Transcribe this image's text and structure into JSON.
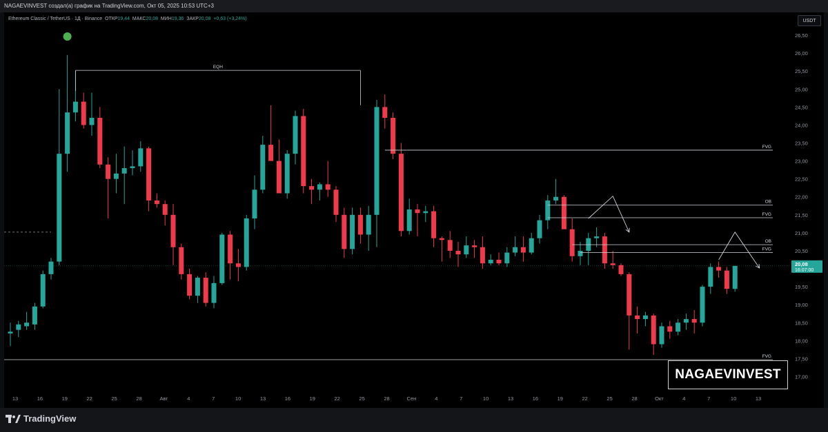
{
  "header": {
    "title": "NAGAEVINVEST создал(а) график на TradingView.com, Окт 05, 2025 10:53 UTC+3"
  },
  "legend": {
    "symbol": "Ethereum Classic / TetherUS · 1Д · Binance",
    "open_label": "ОТКР",
    "open": "19,44",
    "high_label": "МАКС",
    "high": "20,08",
    "low_label": "МИН",
    "low": "19,36",
    "close_label": "ЗАКР",
    "close": "20,08",
    "change": "+0,63 (+3,24%)"
  },
  "currency": "USDT",
  "price_badge": {
    "price": "20,08",
    "countdown": "16:07:00"
  },
  "watermark": "NAGAEVINVEST",
  "footer": {
    "logo_text": "TradingView"
  },
  "colors": {
    "up": "#26a69a",
    "down": "#ef3a4c",
    "line": "#d1d4dc",
    "marker": "#4caf50",
    "background": "#000000"
  },
  "chart_data": {
    "type": "candlestick",
    "ylim": [
      16.55,
      26.75
    ],
    "y_ticks": [
      "17,00",
      "17,50",
      "18,00",
      "18,50",
      "19,00",
      "19,50",
      "20,00",
      "20,50",
      "21,00",
      "21,50",
      "22,00",
      "22,50",
      "23,00",
      "23,50",
      "24,00",
      "24,50",
      "25,00",
      "25,50",
      "26,00",
      "26,50"
    ],
    "x_ticks": [
      "13",
      "16",
      "19",
      "22",
      "25",
      "28",
      "Авг",
      "4",
      "7",
      "10",
      "13",
      "16",
      "19",
      "22",
      "25",
      "28",
      "Сен",
      "4",
      "7",
      "10",
      "13",
      "16",
      "19",
      "22",
      "25",
      "28",
      "Окт",
      "4",
      "7",
      "10",
      "13"
    ],
    "candles": [
      {
        "o": 18.2,
        "h": 18.5,
        "l": 17.85,
        "c": 18.25
      },
      {
        "o": 18.3,
        "h": 18.55,
        "l": 18.1,
        "c": 18.45
      },
      {
        "o": 18.4,
        "h": 18.8,
        "l": 18.3,
        "c": 18.5
      },
      {
        "o": 18.45,
        "h": 19.05,
        "l": 18.3,
        "c": 18.95
      },
      {
        "o": 18.95,
        "h": 19.95,
        "l": 18.9,
        "c": 19.85
      },
      {
        "o": 19.85,
        "h": 20.3,
        "l": 19.7,
        "c": 20.2
      },
      {
        "o": 20.2,
        "h": 25.0,
        "l": 20.1,
        "c": 23.2
      },
      {
        "o": 23.2,
        "h": 25.95,
        "l": 22.7,
        "c": 24.35
      },
      {
        "o": 24.35,
        "h": 25.5,
        "l": 24.1,
        "c": 24.65
      },
      {
        "o": 24.65,
        "h": 24.9,
        "l": 23.9,
        "c": 24.0
      },
      {
        "o": 24.0,
        "h": 24.9,
        "l": 23.7,
        "c": 24.2
      },
      {
        "o": 24.2,
        "h": 24.5,
        "l": 22.8,
        "c": 22.9
      },
      {
        "o": 22.9,
        "h": 23.1,
        "l": 21.4,
        "c": 22.5
      },
      {
        "o": 22.5,
        "h": 23.2,
        "l": 22.1,
        "c": 22.65
      },
      {
        "o": 22.65,
        "h": 23.4,
        "l": 21.8,
        "c": 22.8
      },
      {
        "o": 22.8,
        "h": 23.3,
        "l": 22.6,
        "c": 22.85
      },
      {
        "o": 22.85,
        "h": 23.55,
        "l": 22.7,
        "c": 23.35
      },
      {
        "o": 23.35,
        "h": 23.4,
        "l": 21.6,
        "c": 21.9
      },
      {
        "o": 21.9,
        "h": 22.1,
        "l": 21.7,
        "c": 21.8
      },
      {
        "o": 21.8,
        "h": 21.9,
        "l": 21.2,
        "c": 21.5
      },
      {
        "o": 21.5,
        "h": 21.8,
        "l": 20.1,
        "c": 20.6
      },
      {
        "o": 20.6,
        "h": 20.7,
        "l": 19.7,
        "c": 19.85
      },
      {
        "o": 19.85,
        "h": 20.0,
        "l": 19.15,
        "c": 19.25
      },
      {
        "o": 19.25,
        "h": 19.8,
        "l": 19.05,
        "c": 19.75
      },
      {
        "o": 19.75,
        "h": 19.9,
        "l": 18.95,
        "c": 19.05
      },
      {
        "o": 19.05,
        "h": 19.8,
        "l": 18.9,
        "c": 19.6
      },
      {
        "o": 19.6,
        "h": 21.0,
        "l": 19.55,
        "c": 20.95
      },
      {
        "o": 20.95,
        "h": 21.05,
        "l": 19.7,
        "c": 20.15
      },
      {
        "o": 20.15,
        "h": 20.55,
        "l": 19.65,
        "c": 20.05
      },
      {
        "o": 20.05,
        "h": 21.5,
        "l": 19.95,
        "c": 21.4
      },
      {
        "o": 21.4,
        "h": 22.6,
        "l": 21.1,
        "c": 22.2
      },
      {
        "o": 22.2,
        "h": 23.7,
        "l": 22.1,
        "c": 23.45
      },
      {
        "o": 23.45,
        "h": 24.55,
        "l": 23.0,
        "c": 23.0
      },
      {
        "o": 23.0,
        "h": 23.6,
        "l": 22.7,
        "c": 22.1
      },
      {
        "o": 22.1,
        "h": 23.3,
        "l": 21.95,
        "c": 23.2
      },
      {
        "o": 23.2,
        "h": 24.4,
        "l": 22.9,
        "c": 24.25
      },
      {
        "o": 24.25,
        "h": 24.45,
        "l": 22.1,
        "c": 22.3
      },
      {
        "o": 22.3,
        "h": 22.5,
        "l": 21.8,
        "c": 22.2
      },
      {
        "o": 22.2,
        "h": 22.4,
        "l": 21.9,
        "c": 22.35
      },
      {
        "o": 22.35,
        "h": 23.0,
        "l": 22.0,
        "c": 22.2
      },
      {
        "o": 22.2,
        "h": 22.3,
        "l": 21.3,
        "c": 21.5
      },
      {
        "o": 21.5,
        "h": 21.7,
        "l": 20.3,
        "c": 20.55
      },
      {
        "o": 20.55,
        "h": 21.7,
        "l": 20.4,
        "c": 21.5
      },
      {
        "o": 21.5,
        "h": 21.7,
        "l": 20.7,
        "c": 20.95
      },
      {
        "o": 20.95,
        "h": 21.75,
        "l": 20.5,
        "c": 21.5
      },
      {
        "o": 21.5,
        "h": 24.7,
        "l": 20.6,
        "c": 24.5
      },
      {
        "o": 24.5,
        "h": 24.85,
        "l": 23.9,
        "c": 24.2
      },
      {
        "o": 24.2,
        "h": 24.35,
        "l": 23.05,
        "c": 23.2
      },
      {
        "o": 23.2,
        "h": 23.5,
        "l": 20.9,
        "c": 21.05
      },
      {
        "o": 21.05,
        "h": 21.95,
        "l": 20.95,
        "c": 21.65
      },
      {
        "o": 21.65,
        "h": 21.8,
        "l": 20.9,
        "c": 21.55
      },
      {
        "o": 21.55,
        "h": 21.75,
        "l": 21.3,
        "c": 21.6
      },
      {
        "o": 21.6,
        "h": 21.75,
        "l": 20.6,
        "c": 20.85
      },
      {
        "o": 20.85,
        "h": 20.9,
        "l": 20.2,
        "c": 20.8
      },
      {
        "o": 20.8,
        "h": 21.05,
        "l": 20.3,
        "c": 20.5
      },
      {
        "o": 20.5,
        "h": 20.75,
        "l": 20.05,
        "c": 20.4
      },
      {
        "o": 20.4,
        "h": 20.9,
        "l": 20.3,
        "c": 20.65
      },
      {
        "o": 20.65,
        "h": 20.8,
        "l": 20.3,
        "c": 20.6
      },
      {
        "o": 20.6,
        "h": 20.9,
        "l": 20.0,
        "c": 20.15
      },
      {
        "o": 20.15,
        "h": 20.4,
        "l": 20.1,
        "c": 20.25
      },
      {
        "o": 20.25,
        "h": 20.45,
        "l": 20.1,
        "c": 20.15
      },
      {
        "o": 20.15,
        "h": 20.6,
        "l": 20.05,
        "c": 20.45
      },
      {
        "o": 20.45,
        "h": 20.9,
        "l": 20.35,
        "c": 20.6
      },
      {
        "o": 20.6,
        "h": 20.9,
        "l": 20.2,
        "c": 20.45
      },
      {
        "o": 20.45,
        "h": 21.0,
        "l": 20.4,
        "c": 20.85
      },
      {
        "o": 20.85,
        "h": 21.5,
        "l": 20.7,
        "c": 21.35
      },
      {
        "o": 21.35,
        "h": 22.05,
        "l": 21.1,
        "c": 21.9
      },
      {
        "o": 21.9,
        "h": 22.5,
        "l": 21.8,
        "c": 22.0
      },
      {
        "o": 22.0,
        "h": 22.05,
        "l": 21.2,
        "c": 21.1
      },
      {
        "o": 21.1,
        "h": 21.4,
        "l": 20.2,
        "c": 20.35
      },
      {
        "o": 20.35,
        "h": 20.75,
        "l": 20.1,
        "c": 20.5
      },
      {
        "o": 20.5,
        "h": 21.0,
        "l": 20.1,
        "c": 20.85
      },
      {
        "o": 20.85,
        "h": 21.15,
        "l": 20.6,
        "c": 20.9
      },
      {
        "o": 20.9,
        "h": 21.0,
        "l": 20.0,
        "c": 20.15
      },
      {
        "o": 20.15,
        "h": 20.5,
        "l": 20.0,
        "c": 20.1
      },
      {
        "o": 20.1,
        "h": 20.15,
        "l": 19.8,
        "c": 19.85
      },
      {
        "o": 19.85,
        "h": 19.9,
        "l": 17.75,
        "c": 18.7
      },
      {
        "o": 18.7,
        "h": 18.95,
        "l": 18.2,
        "c": 18.6
      },
      {
        "o": 18.6,
        "h": 18.8,
        "l": 18.4,
        "c": 18.7
      },
      {
        "o": 18.7,
        "h": 18.75,
        "l": 17.6,
        "c": 17.9
      },
      {
        "o": 17.9,
        "h": 18.5,
        "l": 17.8,
        "c": 18.4
      },
      {
        "o": 18.4,
        "h": 18.55,
        "l": 18.05,
        "c": 18.25
      },
      {
        "o": 18.25,
        "h": 18.6,
        "l": 18.15,
        "c": 18.5
      },
      {
        "o": 18.5,
        "h": 18.75,
        "l": 18.3,
        "c": 18.6
      },
      {
        "o": 18.6,
        "h": 18.85,
        "l": 18.2,
        "c": 18.5
      },
      {
        "o": 18.5,
        "h": 19.55,
        "l": 18.4,
        "c": 19.5
      },
      {
        "o": 19.5,
        "h": 20.15,
        "l": 19.3,
        "c": 20.05
      },
      {
        "o": 20.05,
        "h": 20.2,
        "l": 19.75,
        "c": 19.95
      },
      {
        "o": 19.95,
        "h": 20.05,
        "l": 19.3,
        "c": 19.44
      },
      {
        "o": 19.44,
        "h": 20.08,
        "l": 19.36,
        "c": 20.08
      }
    ],
    "levels": [
      {
        "label": "EQH",
        "price": 25.52
      },
      {
        "label": "FVG",
        "price": 23.3
      },
      {
        "label": "OB",
        "price": 21.77
      },
      {
        "label": "FVG",
        "price": 21.42
      },
      {
        "label": "OB",
        "price": 20.67
      },
      {
        "label": "FVG",
        "price": 20.45
      },
      {
        "label": "FVG",
        "price": 17.47
      }
    ],
    "projections": [
      {
        "points": [
          [
            21.4,
            0
          ],
          [
            22.02,
            3
          ],
          [
            21.02,
            5
          ]
        ]
      },
      {
        "points": [
          [
            20.25,
            0
          ],
          [
            21.02,
            2
          ],
          [
            20.02,
            5
          ]
        ]
      }
    ],
    "current_price": 20.08,
    "dashed_level": 21.02
  }
}
